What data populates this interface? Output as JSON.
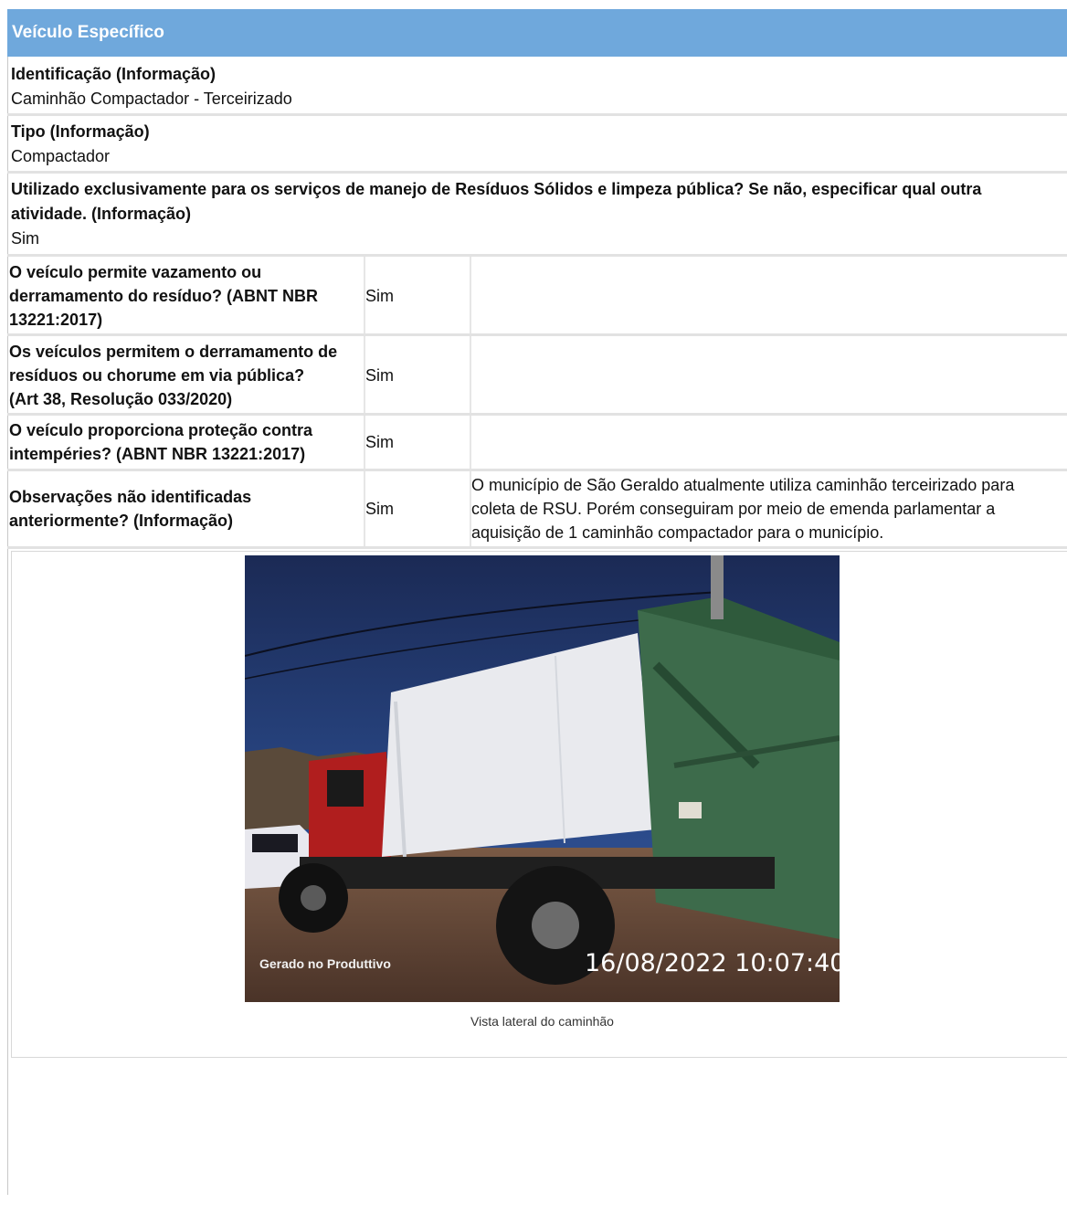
{
  "section": {
    "title": "Veículo Específico"
  },
  "fields": [
    {
      "label": "Identificação (Informação)",
      "value": "Caminhão Compactador - Terceirizado"
    },
    {
      "label": "Tipo (Informação)",
      "value": "Compactador"
    },
    {
      "label_line1": "Utilizado exclusivamente para os serviços de manejo de Resíduos Sólidos e limpeza pública? Se não, especificar qual outra",
      "label_line2": "atividade. (Informação)",
      "value": "Sim"
    }
  ],
  "table": [
    {
      "q1": "O veículo permite vazamento ou",
      "q2": "derramamento do resíduo? (ABNT NBR",
      "q3": "13221:2017)",
      "answer": "Sim",
      "note": ""
    },
    {
      "q1": "Os veículos permitem o derramamento de",
      "q2": "resíduos ou chorume em via pública?",
      "q3": "(Art 38, Resolução 033/2020)",
      "answer": "Sim",
      "note": ""
    },
    {
      "q1": "O veículo proporciona proteção contra",
      "q2": "intempéries? (ABNT NBR 13221:2017)",
      "answer": "Sim",
      "note": ""
    },
    {
      "q1": "Observações não identificadas",
      "q2": "anteriormente? (Informação)",
      "answer": "Sim",
      "note1": "O município de São Geraldo atualmente utiliza caminhão terceirizado para",
      "note2": "coleta de RSU. Porém conseguiram por meio de emenda parlamentar a",
      "note3": "aquisição de 1 caminhão compactador para o município."
    }
  ],
  "photo": {
    "watermark_left": "Gerado no Produttivo",
    "timestamp": "16/08/2022 10:07:40",
    "caption": "Vista lateral do caminhão"
  },
  "colors": {
    "header_bg": "#6fa8dc",
    "header_text": "#ffffff",
    "separator": "#e2e2e2"
  }
}
